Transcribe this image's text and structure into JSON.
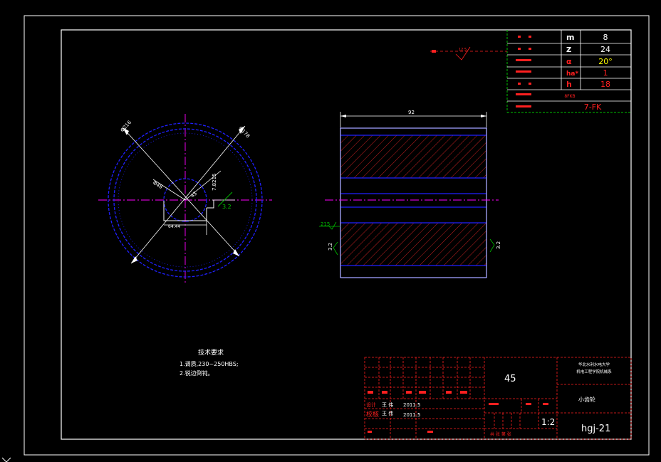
{
  "params": {
    "m_symbol": "m",
    "m_value": "8",
    "z_symbol": "Z",
    "z_value": "24",
    "alpha_symbol": "α",
    "alpha_value": "20°",
    "ha_symbol": "ha*",
    "ha_value": "1",
    "h_symbol": "h",
    "h_value": "18",
    "mid_label": "8FKB",
    "grade_value": "7-FK"
  },
  "dims": {
    "tip_diam": "Φ216",
    "root_diam": "Φ178",
    "bore": "Φ48",
    "shaft_step": "64.44",
    "keyway_w": "43",
    "keyway_tol": "7.8215",
    "ra_left": "3.2",
    "width": "92",
    "ra_bore": "215",
    "ra_face_left": "3.2",
    "ra_face_right": "3.2",
    "ra_top": "12.5"
  },
  "notes": {
    "heading": "技术要求",
    "line1": "1.调质,230~250HBS;",
    "line2": "2.锐边倒钝。"
  },
  "title_block": {
    "material": "45",
    "school": "华北水利水电大学",
    "dept": "机电工程学院机械系",
    "part_name": "小齿轮",
    "scale": "1:2",
    "drawing_no": "hgj-21",
    "designer_label": "设计",
    "designer_name": "王 伟",
    "design_date": "2011.5",
    "checker_label": "校核",
    "checker_name": "王 伟",
    "check_date": "2011.5",
    "sheet_note": "共 张 第 张"
  },
  "colors": {
    "border": "#ffffff",
    "red": "#ff2020",
    "blue": "#2020ff",
    "magenta": "#ff00ff",
    "green": "#00c000",
    "hatch": "#c02020"
  }
}
